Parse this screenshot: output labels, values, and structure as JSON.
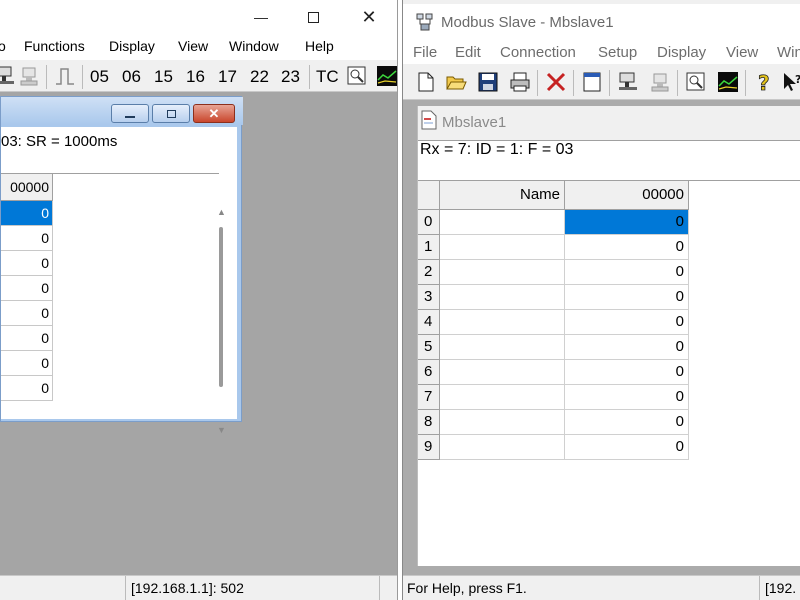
{
  "left_window": {
    "menu": [
      "o",
      "Functions",
      "Display",
      "View",
      "Window",
      "Help"
    ],
    "toolbar_codes": [
      "05",
      "06",
      "15",
      "16",
      "17",
      "22",
      "23",
      "TC"
    ],
    "child": {
      "info_line": "03: SR = 1000ms",
      "column_header": "00000",
      "values": [
        "0",
        "0",
        "0",
        "0",
        "0",
        "0",
        "0",
        "0"
      ]
    },
    "status": "[192.168.1.1]: 502"
  },
  "right_window": {
    "title": "Modbus Slave - Mbslave1",
    "menu": [
      "File",
      "Edit",
      "Connection",
      "Setup",
      "Display",
      "View",
      "Win"
    ],
    "child": {
      "title": "Mbslave1",
      "info_line": "Rx = 7: ID = 1: F = 03",
      "name_header": "Name",
      "value_header": "00000",
      "rows": [
        {
          "index": "0",
          "name": "",
          "value": "0"
        },
        {
          "index": "1",
          "name": "",
          "value": "0"
        },
        {
          "index": "2",
          "name": "",
          "value": "0"
        },
        {
          "index": "3",
          "name": "",
          "value": "0"
        },
        {
          "index": "4",
          "name": "",
          "value": "0"
        },
        {
          "index": "5",
          "name": "",
          "value": "0"
        },
        {
          "index": "6",
          "name": "",
          "value": "0"
        },
        {
          "index": "7",
          "name": "",
          "value": "0"
        },
        {
          "index": "8",
          "name": "",
          "value": "0"
        },
        {
          "index": "9",
          "name": "",
          "value": "0"
        }
      ]
    },
    "status_help": "For Help, press F1.",
    "status_right": "[192."
  },
  "colors": {
    "selection": "#0078d7",
    "mdi_bg": "#ababab"
  }
}
